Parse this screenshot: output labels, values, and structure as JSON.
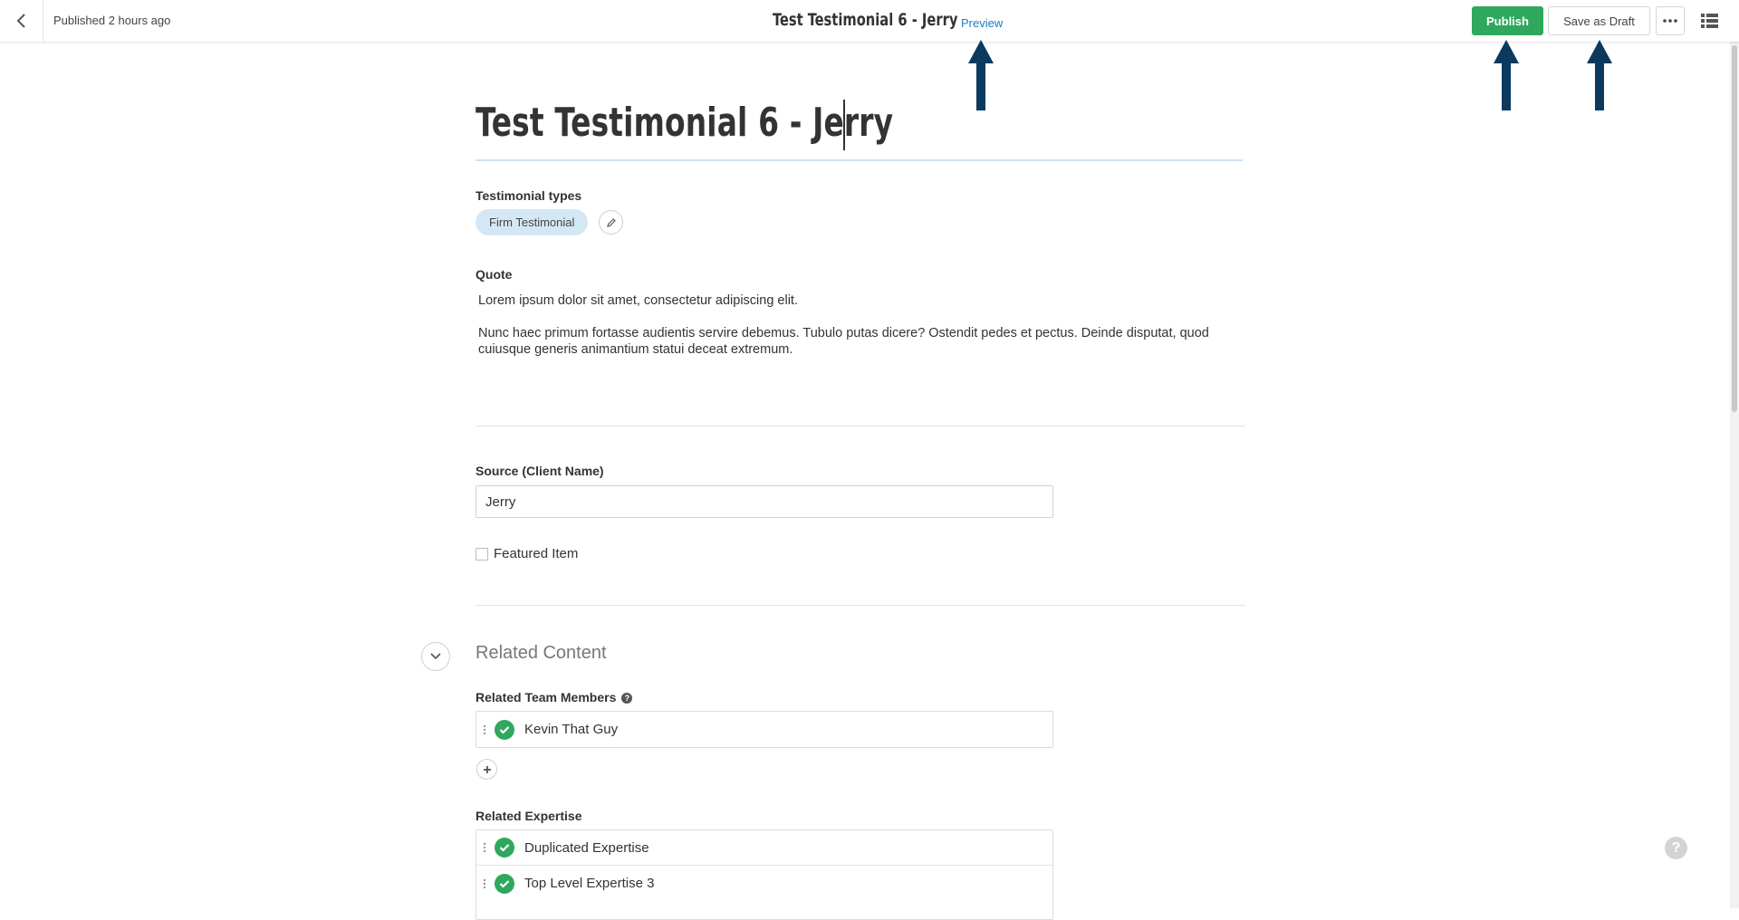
{
  "header": {
    "status": "Published 2 hours ago",
    "title": "Test Testimonial 6 - Jerry",
    "preview_label": "Preview",
    "publish_label": "Publish",
    "save_draft_label": "Save as Draft"
  },
  "icons": {
    "back": "chevron-left-icon",
    "more": "ellipsis-icon",
    "list": "list-view-icon",
    "edit": "pencil-icon",
    "collapse": "chevron-down-icon",
    "add": "plus-icon",
    "check": "check-icon",
    "drag": "drag-handle-icon",
    "help": "question-icon",
    "arrow": "arrow-up-icon"
  },
  "colors": {
    "publish": "#2fa85e",
    "link": "#1a7bbf",
    "chip": "#d4e7f5",
    "arrow": "#0b3a5e"
  },
  "form": {
    "title": "Test Testimonial 6 - Jerry",
    "types": {
      "label": "Testimonial types",
      "chip": "Firm Testimonial"
    },
    "quote": {
      "label": "Quote",
      "paragraph1": "Lorem ipsum dolor sit amet, consectetur adipiscing elit.",
      "paragraph2": "Nunc haec primum fortasse audientis servire debemus. Tubulo putas dicere? Ostendit pedes et pectus. Deinde disputat, quod cuiusque generis animantium statui deceat extremum."
    },
    "source": {
      "label": "Source (Client Name)",
      "value": "Jerry"
    },
    "featured": {
      "label": "Featured Item",
      "checked": false
    }
  },
  "related": {
    "section_title": "Related Content",
    "team": {
      "label": "Related Team Members",
      "help": "?",
      "items": [
        "Kevin That Guy"
      ]
    },
    "expertise": {
      "label": "Related Expertise",
      "items": [
        "Duplicated Expertise",
        "Top Level Expertise 3"
      ]
    }
  },
  "help_float": "?"
}
